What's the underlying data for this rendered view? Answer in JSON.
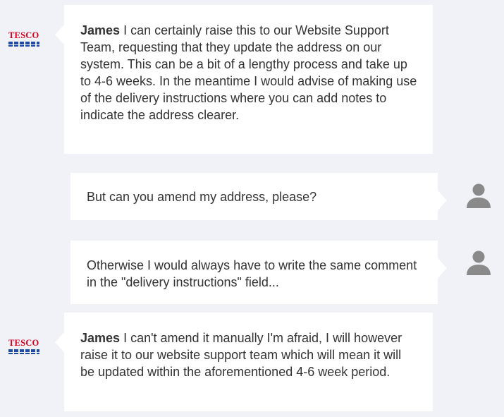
{
  "brand": {
    "logo_text": "TESCO",
    "red": "#d6001c",
    "blue": "#1f4ba3"
  },
  "messages": [
    {
      "sender": "agent",
      "name": "James",
      "text": " I can certainly raise this to our Website Support Team, requesting that they update the address on our system. This can be a bit of a lengthy process and take up to 4-6 weeks. In the meantime I would advise of making use of the delivery instructions where you can add notes to indicate the address clearer."
    },
    {
      "sender": "user",
      "text": "But can you amend my address, please?"
    },
    {
      "sender": "user",
      "text": "Otherwise I would always have to write the same comment in the \"delivery instructions\" field..."
    },
    {
      "sender": "agent",
      "name": "James",
      "text": " I can't amend it manually I'm afraid, I will however raise it to our website support team which will mean it will be updated within the aforementioned 4-6 week period."
    }
  ],
  "icons": {
    "agent_avatar": "tesco-logo-icon",
    "user_avatar": "person-silhouette-icon"
  }
}
